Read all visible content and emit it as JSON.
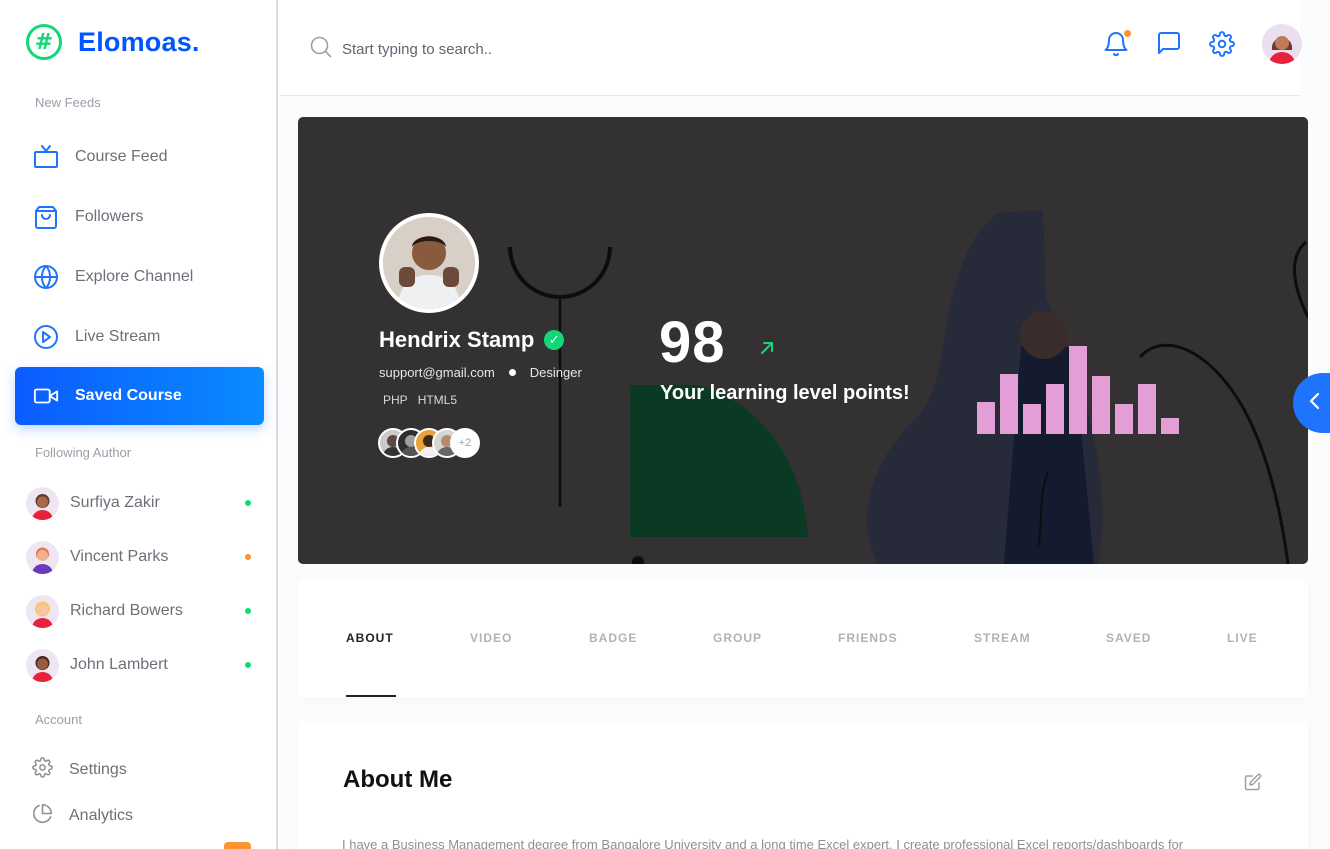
{
  "app": {
    "name": "Elomoas.",
    "logo_glyph": "#",
    "brand_color": "#0055ff",
    "accent_green": "#10d876",
    "accent_orange": "#fe9431"
  },
  "sidebar": {
    "new_feeds_caption": "New Feeds",
    "items": [
      {
        "label": "Course Feed",
        "icon": "tv-icon"
      },
      {
        "label": "Followers",
        "icon": "shopping-bag-icon"
      },
      {
        "label": "Explore Channel",
        "icon": "globe-icon"
      },
      {
        "label": "Live Stream",
        "icon": "play-circle-icon"
      },
      {
        "label": "Saved Course",
        "icon": "video-icon",
        "active": true
      }
    ],
    "following_caption": "Following Author",
    "authors": [
      {
        "name": "Surfiya Zakir",
        "status": "online",
        "status_color": "#10d876"
      },
      {
        "name": "Vincent Parks",
        "status": "away",
        "status_color": "#fe9431"
      },
      {
        "name": "Richard Bowers",
        "status": "online",
        "status_color": "#10d876"
      },
      {
        "name": "John Lambert",
        "status": "online",
        "status_color": "#10d876"
      }
    ],
    "account_caption": "Account",
    "account_items": [
      {
        "label": "Settings",
        "icon": "gear-icon"
      },
      {
        "label": "Analytics",
        "icon": "pie-chart-icon"
      }
    ]
  },
  "header": {
    "search_placeholder": "Start typing to search..",
    "icons": [
      "bell-icon",
      "message-icon",
      "gear-icon",
      "user-avatar"
    ]
  },
  "profile": {
    "name": "Hendrix Stamp",
    "email": "support@gmail.com",
    "role": "Desinger",
    "tags": [
      "PHP",
      "HTML5"
    ],
    "followers_more": "+2",
    "points": "98",
    "points_label": "Your learning level points!"
  },
  "tabs": [
    "ABOUT",
    "VIDEO",
    "BADGE",
    "GROUP",
    "FRIENDS",
    "STREAM",
    "SAVED",
    "LIVE"
  ],
  "active_tab": "ABOUT",
  "about": {
    "title": "About Me",
    "body": "I have a Business Management degree from Bangalore University and a long time Excel expert. I create professional Excel reports/dashboards for"
  }
}
